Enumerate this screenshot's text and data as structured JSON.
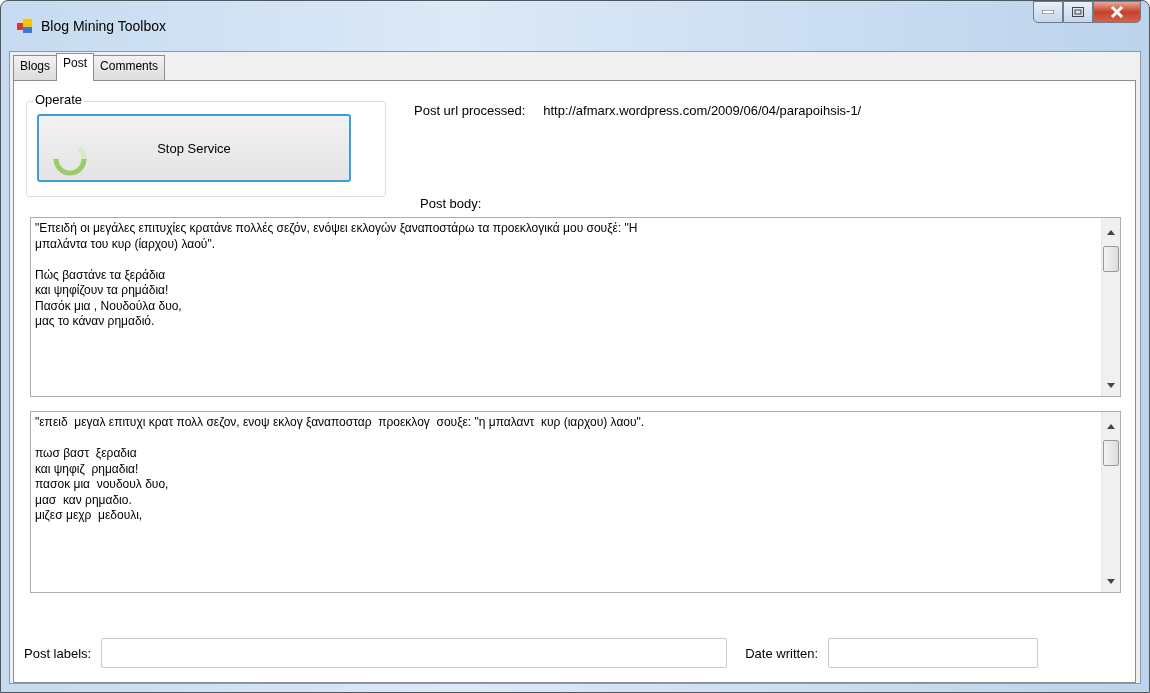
{
  "window": {
    "title": "Blog Mining Toolbox"
  },
  "tabs": [
    {
      "label": "Blogs",
      "selected": false
    },
    {
      "label": "Post",
      "selected": true
    },
    {
      "label": "Comments",
      "selected": false
    }
  ],
  "operate": {
    "title": "Operate",
    "button": "Stop Service"
  },
  "post_url": {
    "label": "Post url processed:",
    "value": "http://afmarx.wordpress.com/2009/06/04/parapoihsis-1/"
  },
  "post_body": {
    "label": "Post body:"
  },
  "original_text": {
    "paragraphs": [
      [
        "\"Επειδή οι μεγάλες επιτυχίες κρατάνε πολλές σεζόν, ενόψει εκλογών ξαναποστάρω τα προεκλογικά μου σουξέ: \"Η",
        "μπαλάντα του κυρ (ίαρχου) λαού\"."
      ],
      [
        "Πώς βαστάνε τα ξεράδια",
        "και ψηφίζουν τα ρημάδια!",
        "Πασόκ μια , Νουδούλα δυο,",
        "μας το κάναν ρημαδιό."
      ]
    ]
  },
  "stemmed_text": {
    "paragraphs": [
      [
        "\"επειδ  μεγαλ επιτυχι κρατ πολλ σεζον, ενοψ εκλογ ξαναποσταρ  προεκλογ  σουξε: \"η μπαλαντ  κυρ (ιαρχου) λαου\"."
      ],
      [
        "πωσ βαστ  ξεραδια",
        "και ψηφιζ  ρημαδια!",
        "πασοκ μια  νουδουλ δυο,",
        "μασ  καν ρημαδιο.",
        "μιζεσ μεχρ  μεδουλι,"
      ]
    ]
  },
  "post_labels": {
    "label": "Post labels:"
  },
  "date_written": {
    "label": "Date written:"
  }
}
